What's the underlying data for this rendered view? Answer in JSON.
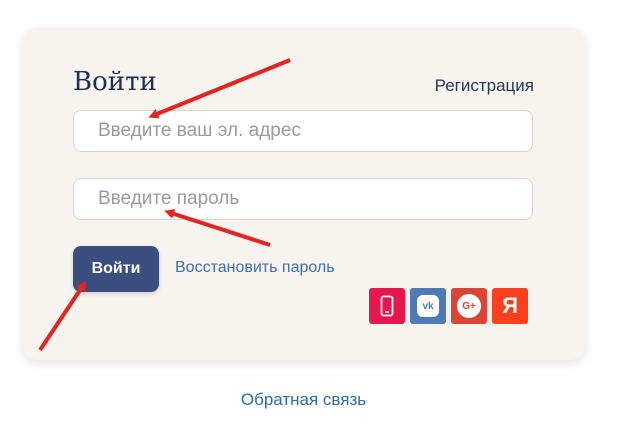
{
  "login": {
    "title": "Войти",
    "register_link": "Регистрация",
    "email_placeholder": "Введите ваш эл. адрес",
    "password_placeholder": "Введите пароль",
    "submit_label": "Войти",
    "restore_link": "Восстановить пароль"
  },
  "social": [
    {
      "icon": "phone-icon",
      "color": "#e8184f"
    },
    {
      "icon": "vk-icon",
      "label": "vk",
      "color": "#4f7ab5"
    },
    {
      "icon": "google-plus-icon",
      "label": "G+",
      "color": "#db4437"
    },
    {
      "icon": "yandex-icon",
      "label": "Я",
      "color": "#fc3f1d"
    }
  ],
  "footer": {
    "feedback_link": "Обратная связь"
  },
  "annotation": {
    "arrow_color": "#e52421"
  }
}
